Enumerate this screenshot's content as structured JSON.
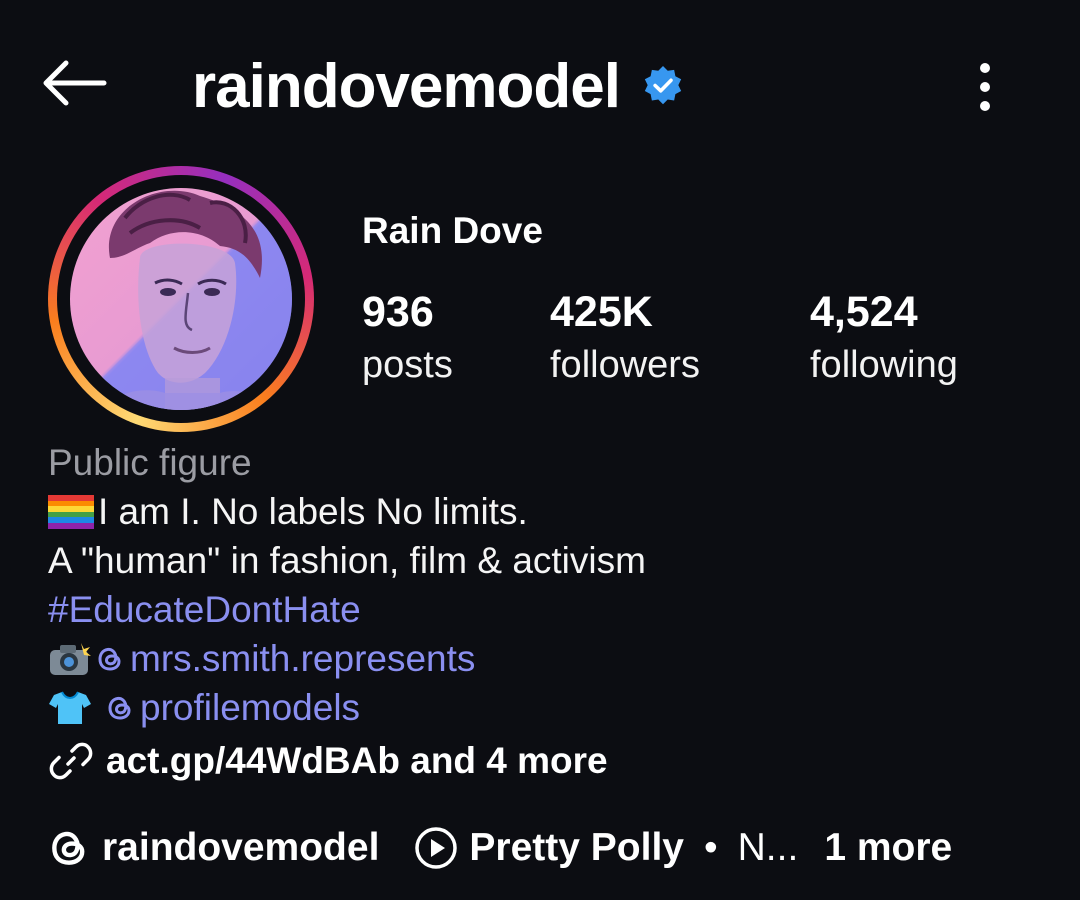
{
  "header": {
    "back_icon": "arrow-left-icon",
    "username": "raindovemodel",
    "verified_icon": "verified-badge-icon",
    "more_icon": "more-vertical-icon"
  },
  "profile": {
    "display_name": "Rain Dove",
    "stats": [
      {
        "value": "936",
        "label": "posts"
      },
      {
        "value": "425K",
        "label": "followers"
      },
      {
        "value": "4,524",
        "label": "following"
      }
    ],
    "category": "Public figure",
    "bio": {
      "line1": "I am I. No labels No limits.",
      "line2": "A \"human\" in fashion, film & activism",
      "hashtag": "#EducateDontHate",
      "mention1": "mrs.smith.represents",
      "mention2": "profilemodels"
    },
    "link": {
      "icon": "link-icon",
      "text": "act.gp/44WdBAb and 4 more"
    }
  },
  "chips": {
    "threads_label": "raindovemodel",
    "music_title": "Pretty Polly",
    "music_sep": "•",
    "music_trunc": "N...",
    "more_label": "1 more"
  },
  "colors": {
    "background": "#0c0d12",
    "link_blue": "#8a8ff0",
    "verified_blue": "#3797f0",
    "muted": "#9b9ca3"
  }
}
